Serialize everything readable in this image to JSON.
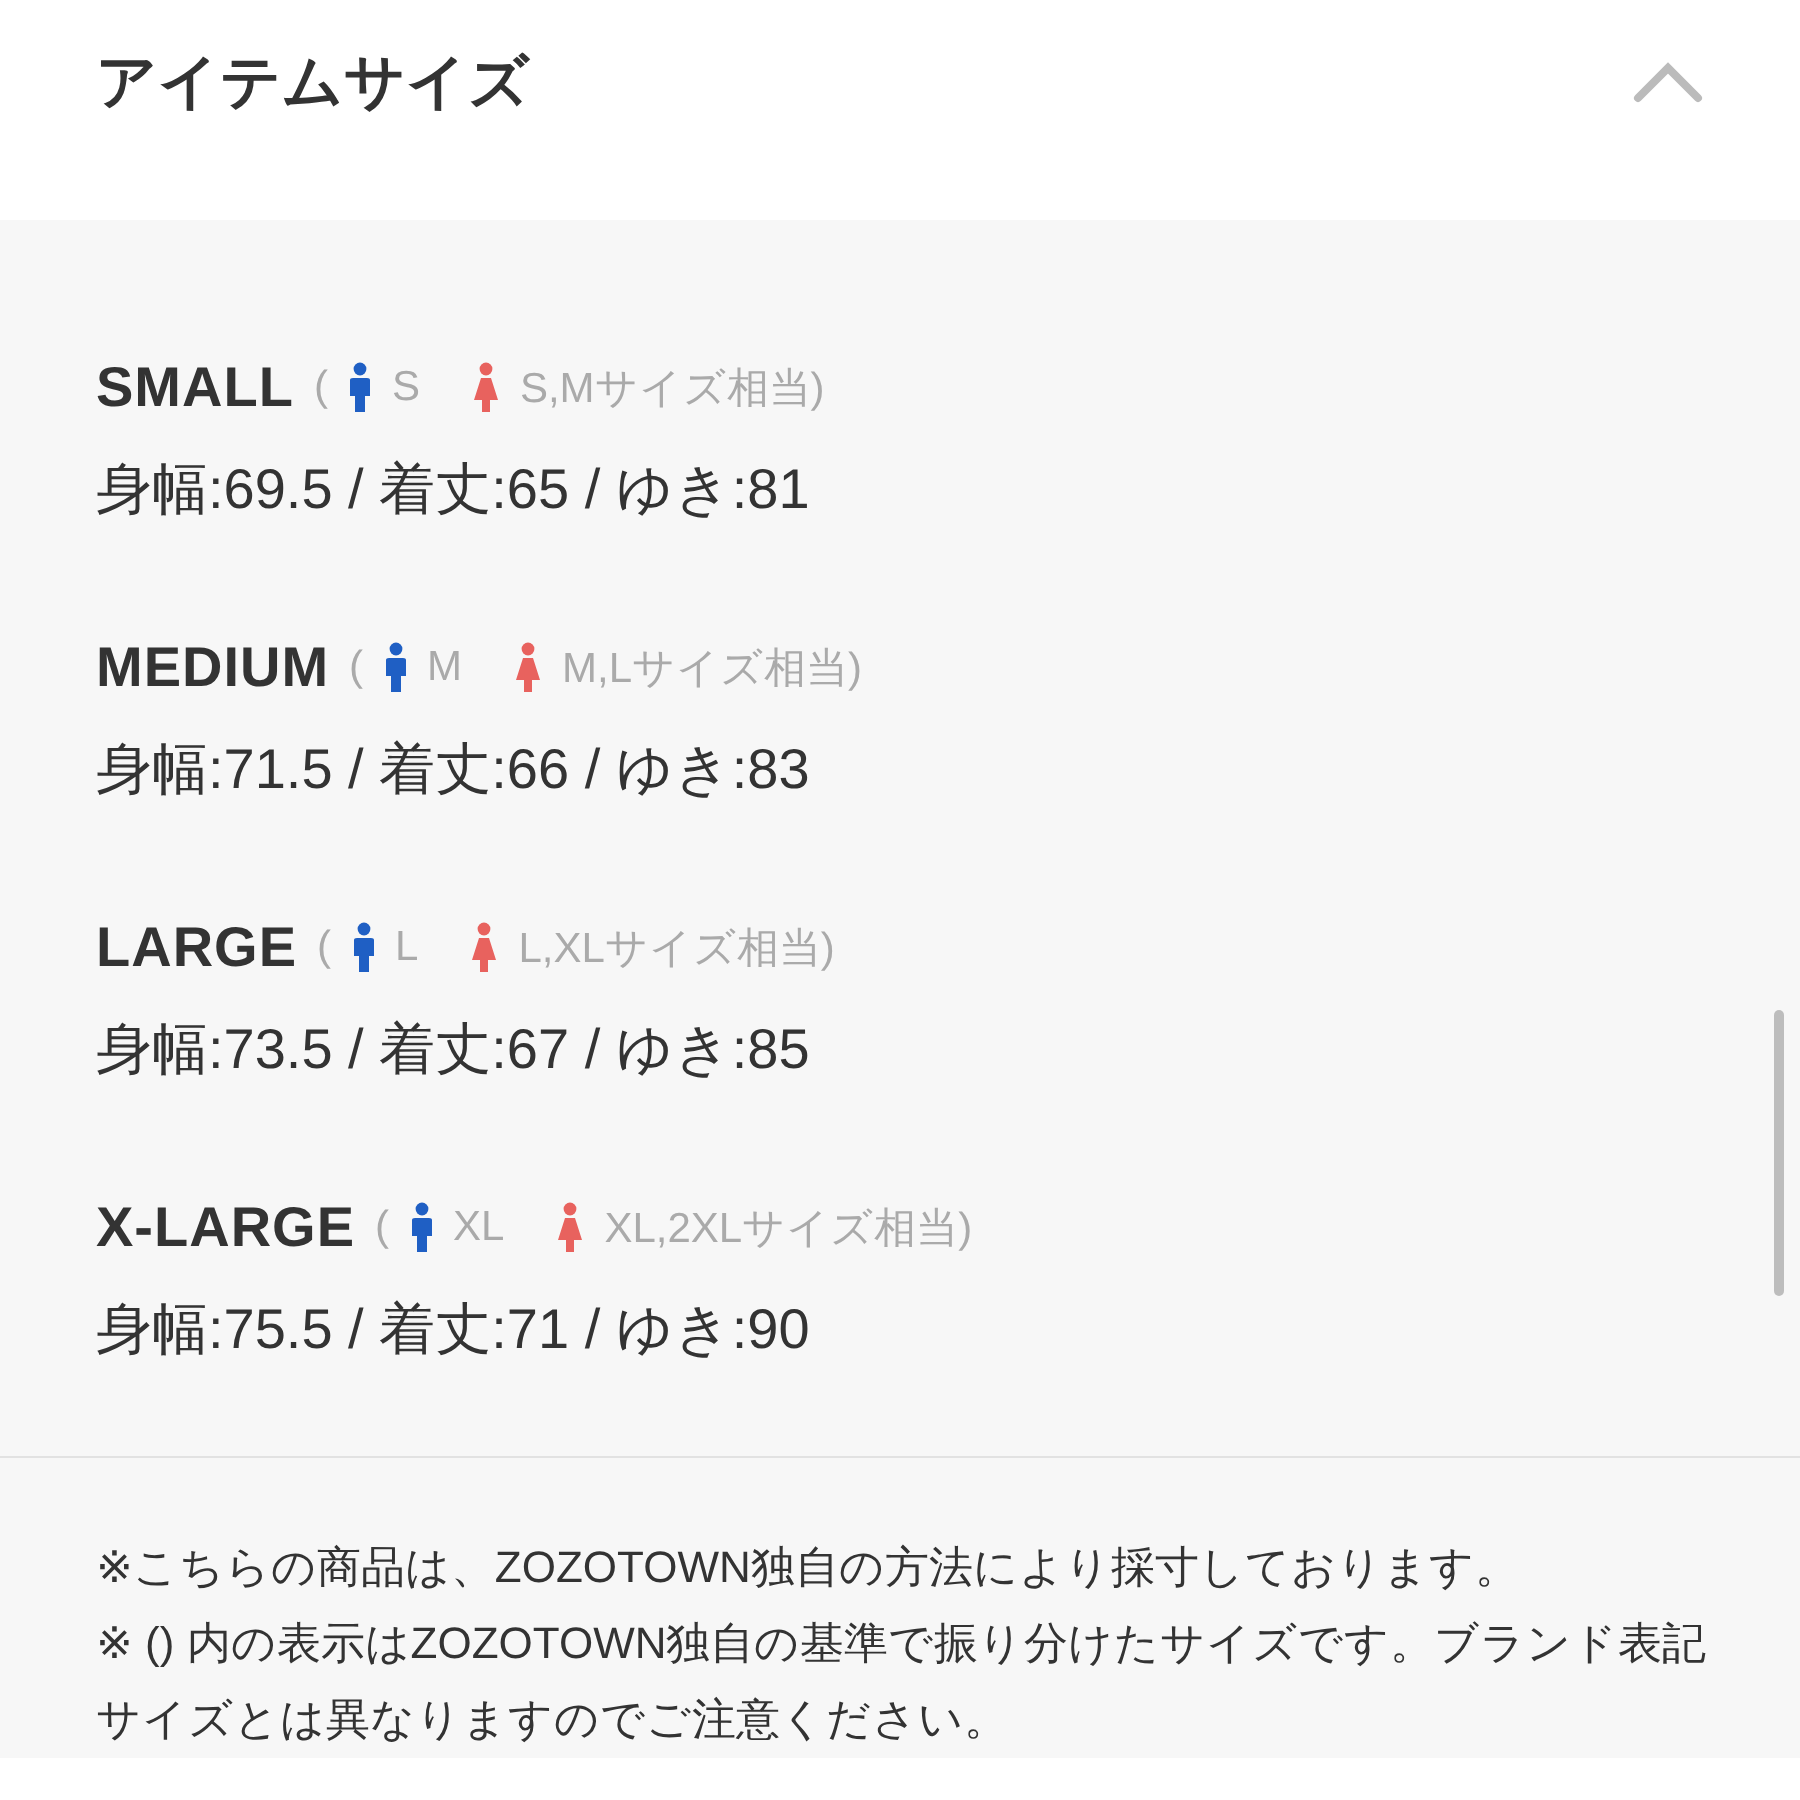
{
  "header": {
    "title": "アイテムサイズ",
    "expanded": true
  },
  "sizes": [
    {
      "name": "SMALL",
      "open": "(",
      "men": "S",
      "women": "S,Mサイズ相当)",
      "measures": "身幅:69.5 / 着丈:65 / ゆき:81"
    },
    {
      "name": "MEDIUM",
      "open": "(",
      "men": "M",
      "women": "M,Lサイズ相当)",
      "measures": "身幅:71.5 / 着丈:66 / ゆき:83"
    },
    {
      "name": "LARGE",
      "open": "(",
      "men": "L",
      "women": "L,XLサイズ相当)",
      "measures": "身幅:73.5 / 着丈:67 / ゆき:85"
    },
    {
      "name": "X-LARGE",
      "open": "(",
      "men": "XL",
      "women": "XL,2XLサイズ相当)",
      "measures": "身幅:75.5 / 着丈:71 / ゆき:90"
    }
  ],
  "notes": [
    "※こちらの商品は、ZOZOTOWN独自の方法により採寸しております。",
    "※ () 内の表示はZOZOTOWN独自の基準で振り分けたサイズです。ブランド表記サイズとは異なりますのでご注意ください。"
  ]
}
